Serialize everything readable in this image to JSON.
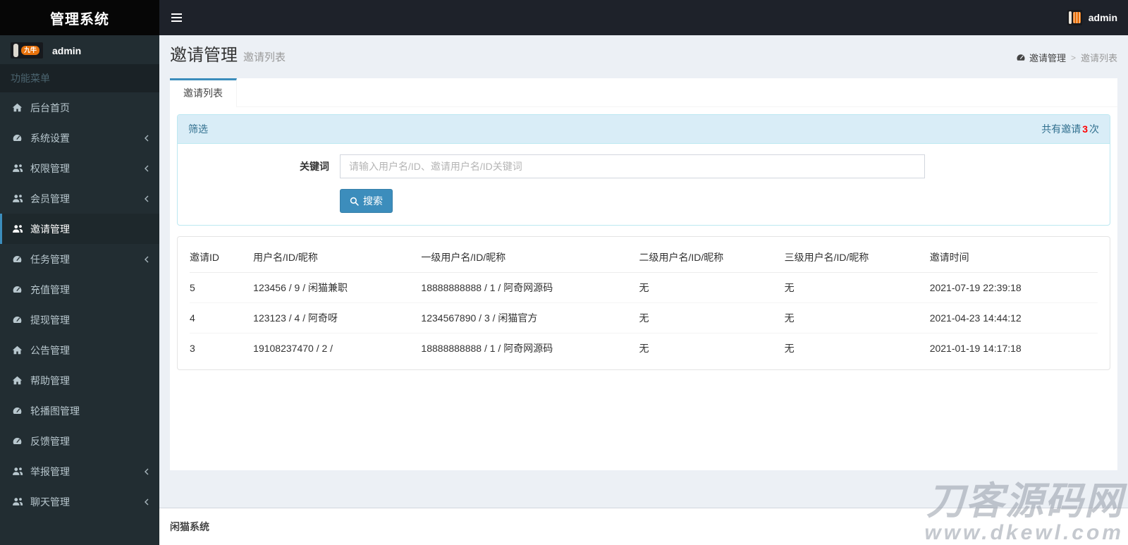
{
  "topbar": {
    "title": "管理系统",
    "user": "admin"
  },
  "sidebar": {
    "user": "admin",
    "avatar_badge": "九牛",
    "section_header": "功能菜单",
    "items": [
      {
        "label": "后台首页",
        "icon": "home",
        "arrow": false,
        "active": false
      },
      {
        "label": "系统设置",
        "icon": "gauge",
        "arrow": true,
        "active": false
      },
      {
        "label": "权限管理",
        "icon": "users",
        "arrow": true,
        "active": false
      },
      {
        "label": "会员管理",
        "icon": "users",
        "arrow": true,
        "active": false
      },
      {
        "label": "邀请管理",
        "icon": "users",
        "arrow": false,
        "active": true
      },
      {
        "label": "任务管理",
        "icon": "gauge",
        "arrow": true,
        "active": false
      },
      {
        "label": "充值管理",
        "icon": "gauge",
        "arrow": false,
        "active": false
      },
      {
        "label": "提现管理",
        "icon": "gauge",
        "arrow": false,
        "active": false
      },
      {
        "label": "公告管理",
        "icon": "home",
        "arrow": false,
        "active": false
      },
      {
        "label": "帮助管理",
        "icon": "home",
        "arrow": false,
        "active": false
      },
      {
        "label": "轮播图管理",
        "icon": "gauge",
        "arrow": false,
        "active": false
      },
      {
        "label": "反馈管理",
        "icon": "gauge",
        "arrow": false,
        "active": false
      },
      {
        "label": "举报管理",
        "icon": "users",
        "arrow": true,
        "active": false
      },
      {
        "label": "聊天管理",
        "icon": "users",
        "arrow": true,
        "active": false
      }
    ]
  },
  "content": {
    "title": "邀请管理",
    "subtitle": "邀请列表",
    "breadcrumb": {
      "root": "邀请管理",
      "separator": ">",
      "current": "邀请列表",
      "root_icon": "gauge-icon"
    },
    "tab": "邀请列表",
    "filter": {
      "title": "筛选",
      "summary_prefix": "共有邀请",
      "summary_count": "3",
      "summary_suffix": "次",
      "keyword_label": "关键词",
      "keyword_value": "",
      "keyword_placeholder": "请输入用户名/ID、邀请用户名/ID关键词",
      "search_label": "搜索",
      "search_icon": "search-icon"
    },
    "table": {
      "headers": [
        "邀请ID",
        "用户名/ID/昵称",
        "一级用户名/ID/昵称",
        "二级用户名/ID/昵称",
        "三级用户名/ID/昵称",
        "邀请时间"
      ],
      "rows": [
        [
          "5",
          "123456 / 9 / 闲猫兼职",
          "18888888888 / 1 / 阿奇网源码",
          "无",
          "无",
          "2021-07-19 22:39:18"
        ],
        [
          "4",
          "123123 / 4 / 阿奇呀",
          "1234567890 / 3 / 闲猫官方",
          "无",
          "无",
          "2021-04-23 14:44:12"
        ],
        [
          "3",
          "19108237470 / 2 /",
          "18888888888 / 1 / 阿奇网源码",
          "无",
          "无",
          "2021-01-19 14:17:18"
        ]
      ]
    }
  },
  "footer": {
    "text": "闲猫系统"
  },
  "watermark": {
    "line1": "刀客源码网",
    "line2": "www.dkewl.com"
  },
  "colors": {
    "accent": "#3c8dbc",
    "topbar_logo_bg": "#060606",
    "topbar_nav_bg": "#1e222a",
    "sidebar_bg": "#222d32",
    "sidebar_active_bg": "#1e282c",
    "content_bg": "#ecf0f5",
    "filter_header_bg": "#d9edf7",
    "filter_border": "#bce8f1",
    "filter_text": "#31708f",
    "count_red": "#ff0000",
    "avatar_badge_orange": "#e8720c"
  }
}
